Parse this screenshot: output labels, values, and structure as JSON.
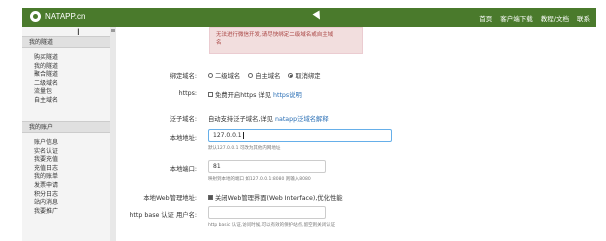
{
  "topbar": {
    "logo": "NATAPP.cn",
    "nav": [
      "首页",
      "客户端下载",
      "教程/文档",
      "联系"
    ]
  },
  "sidebar": {
    "sections": [
      {
        "title": "我的隧道",
        "items": [
          "购买隧道",
          "我的隧道",
          "聚合隧道",
          "二级域名",
          "流量包",
          "自主域名"
        ]
      },
      {
        "title": "我的账户",
        "items": [
          "账户信息",
          "实名认证",
          "我要充值",
          "充值日志",
          "我的账单",
          "发票申请",
          "积分日志",
          "站内消息",
          "我要推广"
        ]
      }
    ]
  },
  "main": {
    "alert_lines": [
      "无法进行微信开发,请尽快绑定二级域名或自主域",
      "名"
    ],
    "bind_domain": {
      "label": "绑定域名:",
      "options": [
        "二级域名",
        "自主域名",
        "取消绑定"
      ],
      "selected": 2
    },
    "https": {
      "label": "https:",
      "text": "免费开启https 详见",
      "link": "https说明"
    },
    "wildcard": {
      "label": "泛子域名:",
      "text": "自动支持泛子域名,详见",
      "link": "natapp泛域名解释"
    },
    "local_addr": {
      "label": "本地地址:",
      "value": "127.0.0.1",
      "hint": "默认127.0.0.1 可改为其他内网地址"
    },
    "local_port": {
      "label": "本地端口:",
      "value": "81",
      "hint": "映射到本地的端口 如127.0.0.1:8080 则输入8080"
    },
    "web_mgmt": {
      "label": "本地Web管理地址:",
      "text": "关闭Web管理界面(Web Interface),优化性能"
    },
    "http_auth": {
      "label": "http base 认证 用户名:",
      "value": "",
      "hint": "http basic 认证,访问时候,可以有效的保护站点,留空则关闭认证"
    }
  }
}
